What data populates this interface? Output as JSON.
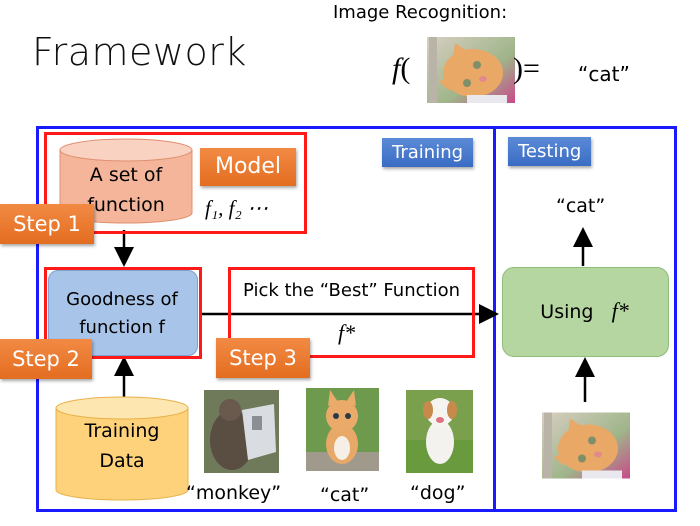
{
  "slide": {
    "title": "Framework",
    "image_recognition": {
      "label": "Image Recognition:",
      "function_symbol": "f",
      "open_paren": "(",
      "close_paren_equals": ")=",
      "output": "“cat”",
      "input_image": "cat-photo"
    }
  },
  "diagram": {
    "sections": {
      "training_label": "Training",
      "testing_label": "Testing"
    },
    "steps": [
      {
        "label": "Step 1"
      },
      {
        "label": "Step 2"
      },
      {
        "label": "Step 3"
      }
    ],
    "model": {
      "cylinder_line1": "A set of",
      "cylinder_line2": "function",
      "tag": "Model",
      "functions": "f₁, f₂ ⋯"
    },
    "goodness": {
      "line1": "Goodness of",
      "line2": "function f"
    },
    "pick_best": {
      "label": "Pick the “Best” Function",
      "result": "f*"
    },
    "training_data": {
      "line1": "Training",
      "line2": "Data",
      "examples": [
        {
          "image": "monkey-photo",
          "caption": "“monkey”"
        },
        {
          "image": "cat-photo",
          "caption": "“cat”"
        },
        {
          "image": "dog-photo",
          "caption": "“dog”"
        }
      ]
    },
    "testing": {
      "output": "“cat”",
      "using_label": "Using",
      "using_symbol": "f*",
      "input_image": "cat-photo"
    },
    "colors": {
      "frame_blue": "#1a1aff",
      "step_red": "#ff1a1a",
      "tag_orange": "#e36d20",
      "tag_blue": "#3a6cc4",
      "model_cylinder": "#f4b59a",
      "goodness_box": "#a8c4e8",
      "training_cylinder": "#fdd27a",
      "using_box": "#b5d6a0"
    }
  }
}
